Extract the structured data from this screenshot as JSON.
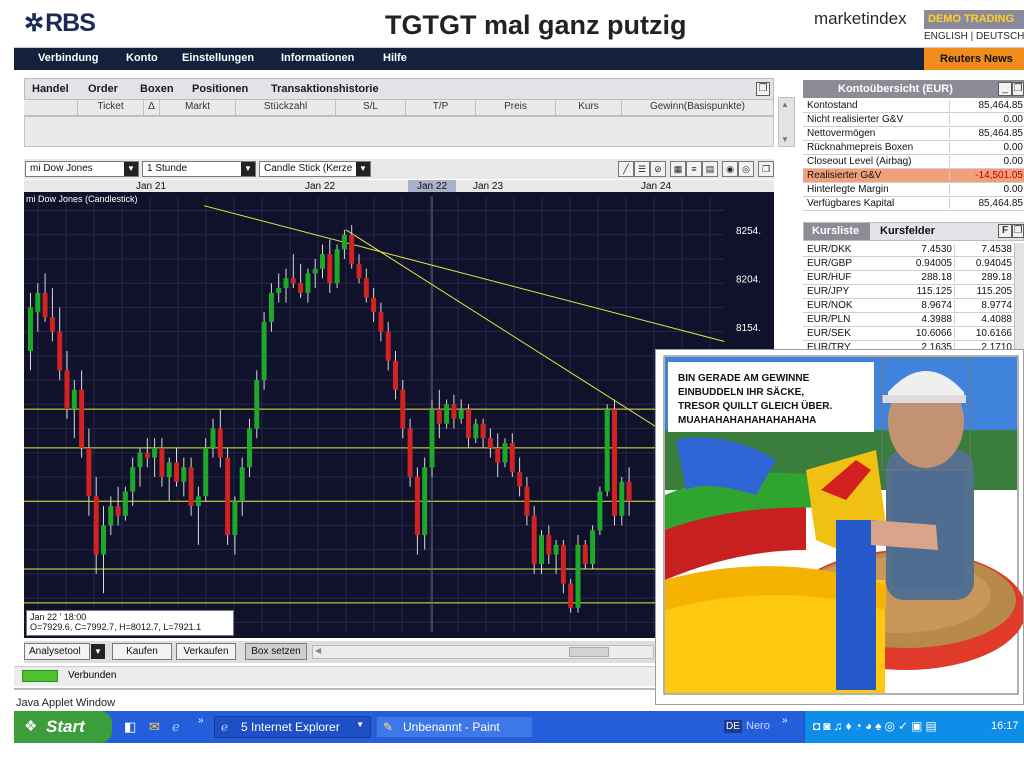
{
  "header": {
    "logo_text": "RBS",
    "title": "TGTGT mal ganz putzig",
    "brand": "marketindex",
    "demo_badge": "DEMO TRADING",
    "language": "ENGLISH | DEUTSCH"
  },
  "menu": {
    "items": [
      {
        "label": "Verbindung"
      },
      {
        "label": "Konto"
      },
      {
        "label": "Einstellungen"
      },
      {
        "label": "Informationen"
      },
      {
        "label": "Hilfe"
      }
    ],
    "reuters_label": "Reuters News"
  },
  "trading_panel": {
    "tabs": [
      {
        "label": "Handel"
      },
      {
        "label": "Order"
      },
      {
        "label": "Boxen"
      },
      {
        "label": "Positionen"
      },
      {
        "label": "Transaktionshistorie"
      }
    ],
    "columns": [
      {
        "label": "Ticket"
      },
      {
        "label": "Δ"
      },
      {
        "label": "Markt"
      },
      {
        "label": "Stückzahl"
      },
      {
        "label": "S/L"
      },
      {
        "label": "T/P"
      },
      {
        "label": "Preis"
      },
      {
        "label": "Kurs"
      },
      {
        "label": "Gewinn(Basispunkte)"
      }
    ]
  },
  "chart_toolbar": {
    "instrument": "mi Dow Jones",
    "interval": "1 Stunde",
    "chart_style": "Candle Stick (Kerze"
  },
  "chart_panel": {
    "chart_title": "mi Dow Jones (Candlestick)",
    "days": [
      "Jan 21",
      "Jan 22",
      "Jan 22",
      "Jan 23",
      "Jan 24"
    ],
    "info_date": "Jan 22 ' 18:00",
    "info_ohlc": "O=7929.6, C=7992.7, H=8012.7, L=7921.1",
    "y_labels": [
      "8254.",
      "8204.",
      "8154."
    ]
  },
  "chart_data": {
    "type": "candlestick",
    "title": "mi Dow Jones (Candlestick)",
    "x_ticks": [
      "Jan 21",
      "Jan 22",
      "Jan 23",
      "Jan 24"
    ],
    "y_ticks": [
      8154,
      8204,
      8254
    ],
    "ylim": [
      7840,
      8290
    ],
    "grid": true,
    "candles": [
      {
        "o": 8130,
        "h": 8190,
        "l": 8110,
        "c": 8175
      },
      {
        "o": 8170,
        "h": 8200,
        "l": 8150,
        "c": 8190
      },
      {
        "o": 8190,
        "h": 8210,
        "l": 8160,
        "c": 8165
      },
      {
        "o": 8165,
        "h": 8195,
        "l": 8140,
        "c": 8150
      },
      {
        "o": 8150,
        "h": 8175,
        "l": 8100,
        "c": 8110
      },
      {
        "o": 8110,
        "h": 8130,
        "l": 8060,
        "c": 8070
      },
      {
        "o": 8070,
        "h": 8100,
        "l": 8040,
        "c": 8090
      },
      {
        "o": 8090,
        "h": 8110,
        "l": 8020,
        "c": 8030
      },
      {
        "o": 8030,
        "h": 8050,
        "l": 7960,
        "c": 7980
      },
      {
        "o": 7980,
        "h": 8000,
        "l": 7900,
        "c": 7920
      },
      {
        "o": 7920,
        "h": 7970,
        "l": 7880,
        "c": 7950
      },
      {
        "o": 7950,
        "h": 7980,
        "l": 7940,
        "c": 7970
      },
      {
        "o": 7970,
        "h": 7990,
        "l": 7950,
        "c": 7960
      },
      {
        "o": 7960,
        "h": 7990,
        "l": 7955,
        "c": 7985
      },
      {
        "o": 7985,
        "h": 8020,
        "l": 7970,
        "c": 8010
      },
      {
        "o": 8010,
        "h": 8030,
        "l": 7990,
        "c": 8025
      },
      {
        "o": 8025,
        "h": 8040,
        "l": 8010,
        "c": 8020
      },
      {
        "o": 8020,
        "h": 8040,
        "l": 8000,
        "c": 8030
      },
      {
        "o": 8030,
        "h": 8040,
        "l": 7990,
        "c": 8000
      },
      {
        "o": 8000,
        "h": 8020,
        "l": 7975,
        "c": 8015
      },
      {
        "o": 8015,
        "h": 8030,
        "l": 7990,
        "c": 7995
      },
      {
        "o": 7995,
        "h": 8020,
        "l": 7980,
        "c": 8010
      },
      {
        "o": 8010,
        "h": 8020,
        "l": 7960,
        "c": 7970
      },
      {
        "o": 7970,
        "h": 7990,
        "l": 7930,
        "c": 7980
      },
      {
        "o": 7980,
        "h": 8040,
        "l": 7975,
        "c": 8030
      },
      {
        "o": 8030,
        "h": 8060,
        "l": 8020,
        "c": 8050
      },
      {
        "o": 8050,
        "h": 8070,
        "l": 8010,
        "c": 8020
      },
      {
        "o": 8020,
        "h": 8030,
        "l": 7930,
        "c": 7940
      },
      {
        "o": 7940,
        "h": 7980,
        "l": 7920,
        "c": 7975
      },
      {
        "o": 7975,
        "h": 8020,
        "l": 7960,
        "c": 8010
      },
      {
        "o": 8010,
        "h": 8060,
        "l": 8000,
        "c": 8050
      },
      {
        "o": 8050,
        "h": 8110,
        "l": 8040,
        "c": 8100
      },
      {
        "o": 8100,
        "h": 8170,
        "l": 8090,
        "c": 8160
      },
      {
        "o": 8160,
        "h": 8200,
        "l": 8150,
        "c": 8190
      },
      {
        "o": 8190,
        "h": 8210,
        "l": 8180,
        "c": 8195
      },
      {
        "o": 8195,
        "h": 8215,
        "l": 8180,
        "c": 8205
      },
      {
        "o": 8205,
        "h": 8230,
        "l": 8195,
        "c": 8200
      },
      {
        "o": 8200,
        "h": 8220,
        "l": 8185,
        "c": 8190
      },
      {
        "o": 8190,
        "h": 8215,
        "l": 8180,
        "c": 8210
      },
      {
        "o": 8210,
        "h": 8225,
        "l": 8195,
        "c": 8215
      },
      {
        "o": 8215,
        "h": 8240,
        "l": 8205,
        "c": 8230
      },
      {
        "o": 8230,
        "h": 8245,
        "l": 8190,
        "c": 8200
      },
      {
        "o": 8200,
        "h": 8240,
        "l": 8195,
        "c": 8235
      },
      {
        "o": 8235,
        "h": 8255,
        "l": 8225,
        "c": 8250
      },
      {
        "o": 8250,
        "h": 8260,
        "l": 8215,
        "c": 8220
      },
      {
        "o": 8220,
        "h": 8230,
        "l": 8200,
        "c": 8205
      },
      {
        "o": 8205,
        "h": 8215,
        "l": 8180,
        "c": 8185
      },
      {
        "o": 8185,
        "h": 8195,
        "l": 8160,
        "c": 8170
      },
      {
        "o": 8170,
        "h": 8180,
        "l": 8140,
        "c": 8150
      },
      {
        "o": 8150,
        "h": 8160,
        "l": 8110,
        "c": 8120
      },
      {
        "o": 8120,
        "h": 8130,
        "l": 8080,
        "c": 8090
      },
      {
        "o": 8090,
        "h": 8100,
        "l": 8040,
        "c": 8050
      },
      {
        "o": 8050,
        "h": 8060,
        "l": 7990,
        "c": 8000
      },
      {
        "o": 8000,
        "h": 8010,
        "l": 7920,
        "c": 7940
      },
      {
        "o": 7940,
        "h": 8020,
        "l": 7925,
        "c": 8010
      },
      {
        "o": 8010,
        "h": 8080,
        "l": 8000,
        "c": 8070
      },
      {
        "o": 8070,
        "h": 8090,
        "l": 8040,
        "c": 8055
      },
      {
        "o": 8055,
        "h": 8080,
        "l": 8050,
        "c": 8075
      },
      {
        "o": 8075,
        "h": 8085,
        "l": 8050,
        "c": 8060
      },
      {
        "o": 8060,
        "h": 8080,
        "l": 8055,
        "c": 8070
      },
      {
        "o": 8070,
        "h": 8075,
        "l": 8030,
        "c": 8040
      },
      {
        "o": 8040,
        "h": 8060,
        "l": 8035,
        "c": 8055
      },
      {
        "o": 8055,
        "h": 8060,
        "l": 8030,
        "c": 8040
      },
      {
        "o": 8040,
        "h": 8050,
        "l": 8020,
        "c": 8030
      },
      {
        "o": 8030,
        "h": 8045,
        "l": 8000,
        "c": 8015
      },
      {
        "o": 8015,
        "h": 8040,
        "l": 8010,
        "c": 8035
      },
      {
        "o": 8035,
        "h": 8045,
        "l": 8000,
        "c": 8005
      },
      {
        "o": 8005,
        "h": 8020,
        "l": 7980,
        "c": 7990
      },
      {
        "o": 7990,
        "h": 8000,
        "l": 7950,
        "c": 7960
      },
      {
        "o": 7960,
        "h": 7970,
        "l": 7900,
        "c": 7910
      },
      {
        "o": 7910,
        "h": 7945,
        "l": 7900,
        "c": 7940
      },
      {
        "o": 7940,
        "h": 7950,
        "l": 7910,
        "c": 7920
      },
      {
        "o": 7920,
        "h": 7935,
        "l": 7900,
        "c": 7930
      },
      {
        "o": 7930,
        "h": 7935,
        "l": 7880,
        "c": 7890
      },
      {
        "o": 7890,
        "h": 7895,
        "l": 7860,
        "c": 7865
      },
      {
        "o": 7865,
        "h": 7940,
        "l": 7860,
        "c": 7930
      },
      {
        "o": 7930,
        "h": 7935,
        "l": 7905,
        "c": 7910
      },
      {
        "o": 7910,
        "h": 7950,
        "l": 7905,
        "c": 7945
      },
      {
        "o": 7945,
        "h": 7990,
        "l": 7940,
        "c": 7985
      },
      {
        "o": 7985,
        "h": 8075,
        "l": 7980,
        "c": 8070
      },
      {
        "o": 8070,
        "h": 8080,
        "l": 7950,
        "c": 7960
      },
      {
        "o": 7960,
        "h": 8000,
        "l": 7950,
        "c": 7995
      },
      {
        "o": 7995,
        "h": 8010,
        "l": 7960,
        "c": 7975
      }
    ]
  },
  "chart_bottom": {
    "analysis_tool": "Analysetool",
    "buy": "Kaufen",
    "sell": "Verkaufen",
    "set_box": "Box setzen"
  },
  "status": {
    "connection": "Verbunden",
    "java_window": "Java Applet Window"
  },
  "account_panel": {
    "title": "Kontoübersicht (EUR)",
    "rows": [
      {
        "label": "Kontostand",
        "value": "85,464.85"
      },
      {
        "label": "Nicht realisierter G&V",
        "value": "0.00"
      },
      {
        "label": "Nettovermögen",
        "value": "85,464.85"
      },
      {
        "label": "Rücknahmepreis Boxen",
        "value": "0.00"
      },
      {
        "label": "Closeout Level (Airbag)",
        "value": "0.00"
      },
      {
        "label": "Realisierter G&V",
        "value": "-14,501.05"
      },
      {
        "label": "Hinterlegte Margin",
        "value": "0.00"
      },
      {
        "label": "Verfügbares Kapital",
        "value": "85,464.85"
      }
    ]
  },
  "rates_panel": {
    "tabs": [
      {
        "label": "Kursliste"
      },
      {
        "label": "Kursfelder"
      }
    ],
    "f_button": "F",
    "rows": [
      {
        "pair": "EUR/DKK",
        "bid": "7.4530",
        "ask": "7.4538"
      },
      {
        "pair": "EUR/GBP",
        "bid": "0.94005",
        "ask": "0.94045"
      },
      {
        "pair": "EUR/HUF",
        "bid": "288.18",
        "ask": "289.18"
      },
      {
        "pair": "EUR/JPY",
        "bid": "115.125",
        "ask": "115.205"
      },
      {
        "pair": "EUR/NOK",
        "bid": "8.9674",
        "ask": "8.9774"
      },
      {
        "pair": "EUR/PLN",
        "bid": "4.3988",
        "ask": "4.4088"
      },
      {
        "pair": "EUR/SEK",
        "bid": "10.6066",
        "ask": "10.6166"
      },
      {
        "pair": "EUR/TRY",
        "bid": "2.1635",
        "ask": "2.1710"
      }
    ]
  },
  "meme": {
    "caption": [
      "BIN GERADE AM GEWINNE",
      "EINBUDDELN IHR SÄCKE,",
      "TRESOR QUILLT GLEICH ÜBER.",
      "MUAHAHAHAHAHAHAHAHA"
    ]
  },
  "taskbar": {
    "start": "Start",
    "tasks": [
      {
        "label": "5 Internet Explorer"
      },
      {
        "label": "Unbenannt - Paint"
      }
    ],
    "lang": "DE",
    "nero": "Nero",
    "clock": "16:17"
  },
  "colors": {
    "navy": "#14213d",
    "orange": "#f08c1c",
    "bull": "#1ea82a",
    "bear": "#d22222",
    "chart_bg": "#10112a",
    "trendline": "#e8e840",
    "loss_highlight": "#f2a07b"
  }
}
